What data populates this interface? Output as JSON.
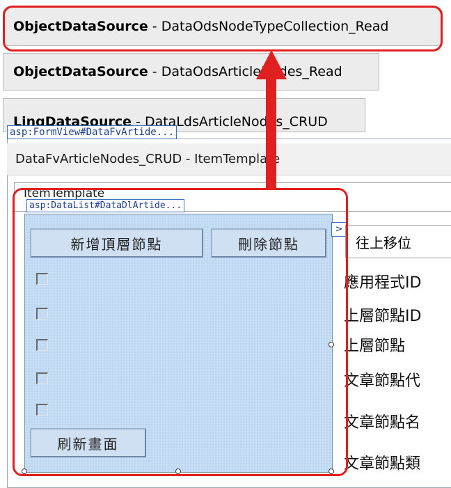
{
  "datasources": [
    {
      "type": "ObjectDataSource",
      "name": "DataOdsNodeTypeCollection_Read"
    },
    {
      "type": "ObjectDataSource",
      "name": "DataOdsArticleNodes_Read"
    },
    {
      "type": "LinqDataSource",
      "name": "DataLdsArticleNodes_CRUD"
    }
  ],
  "separator": "-",
  "formview": {
    "tag": "asp:FormView#DataFvArtide...",
    "header": "DataFvArticleNodes_CRUD - ItemTemplate",
    "itemtemplate_label": "ItemTemplate"
  },
  "datalist": {
    "tag": "asp:DataList#DataDlArtide...",
    "add_top_button": "新增頂層節點",
    "delete_button": "刪除節點",
    "refresh_button": "刷新畫面",
    "checkbox_count": 5
  },
  "chevron": ">",
  "move_up_button": "往上移位",
  "fields": [
    "應用程式ID",
    "上層節點ID",
    "上層節點",
    "文章節點代",
    "文章節點名",
    "文章節點類"
  ],
  "colors": {
    "annotation_red": "#e02020",
    "list_bg": "#c6def5",
    "tag_blue": "#3a6fc4"
  }
}
